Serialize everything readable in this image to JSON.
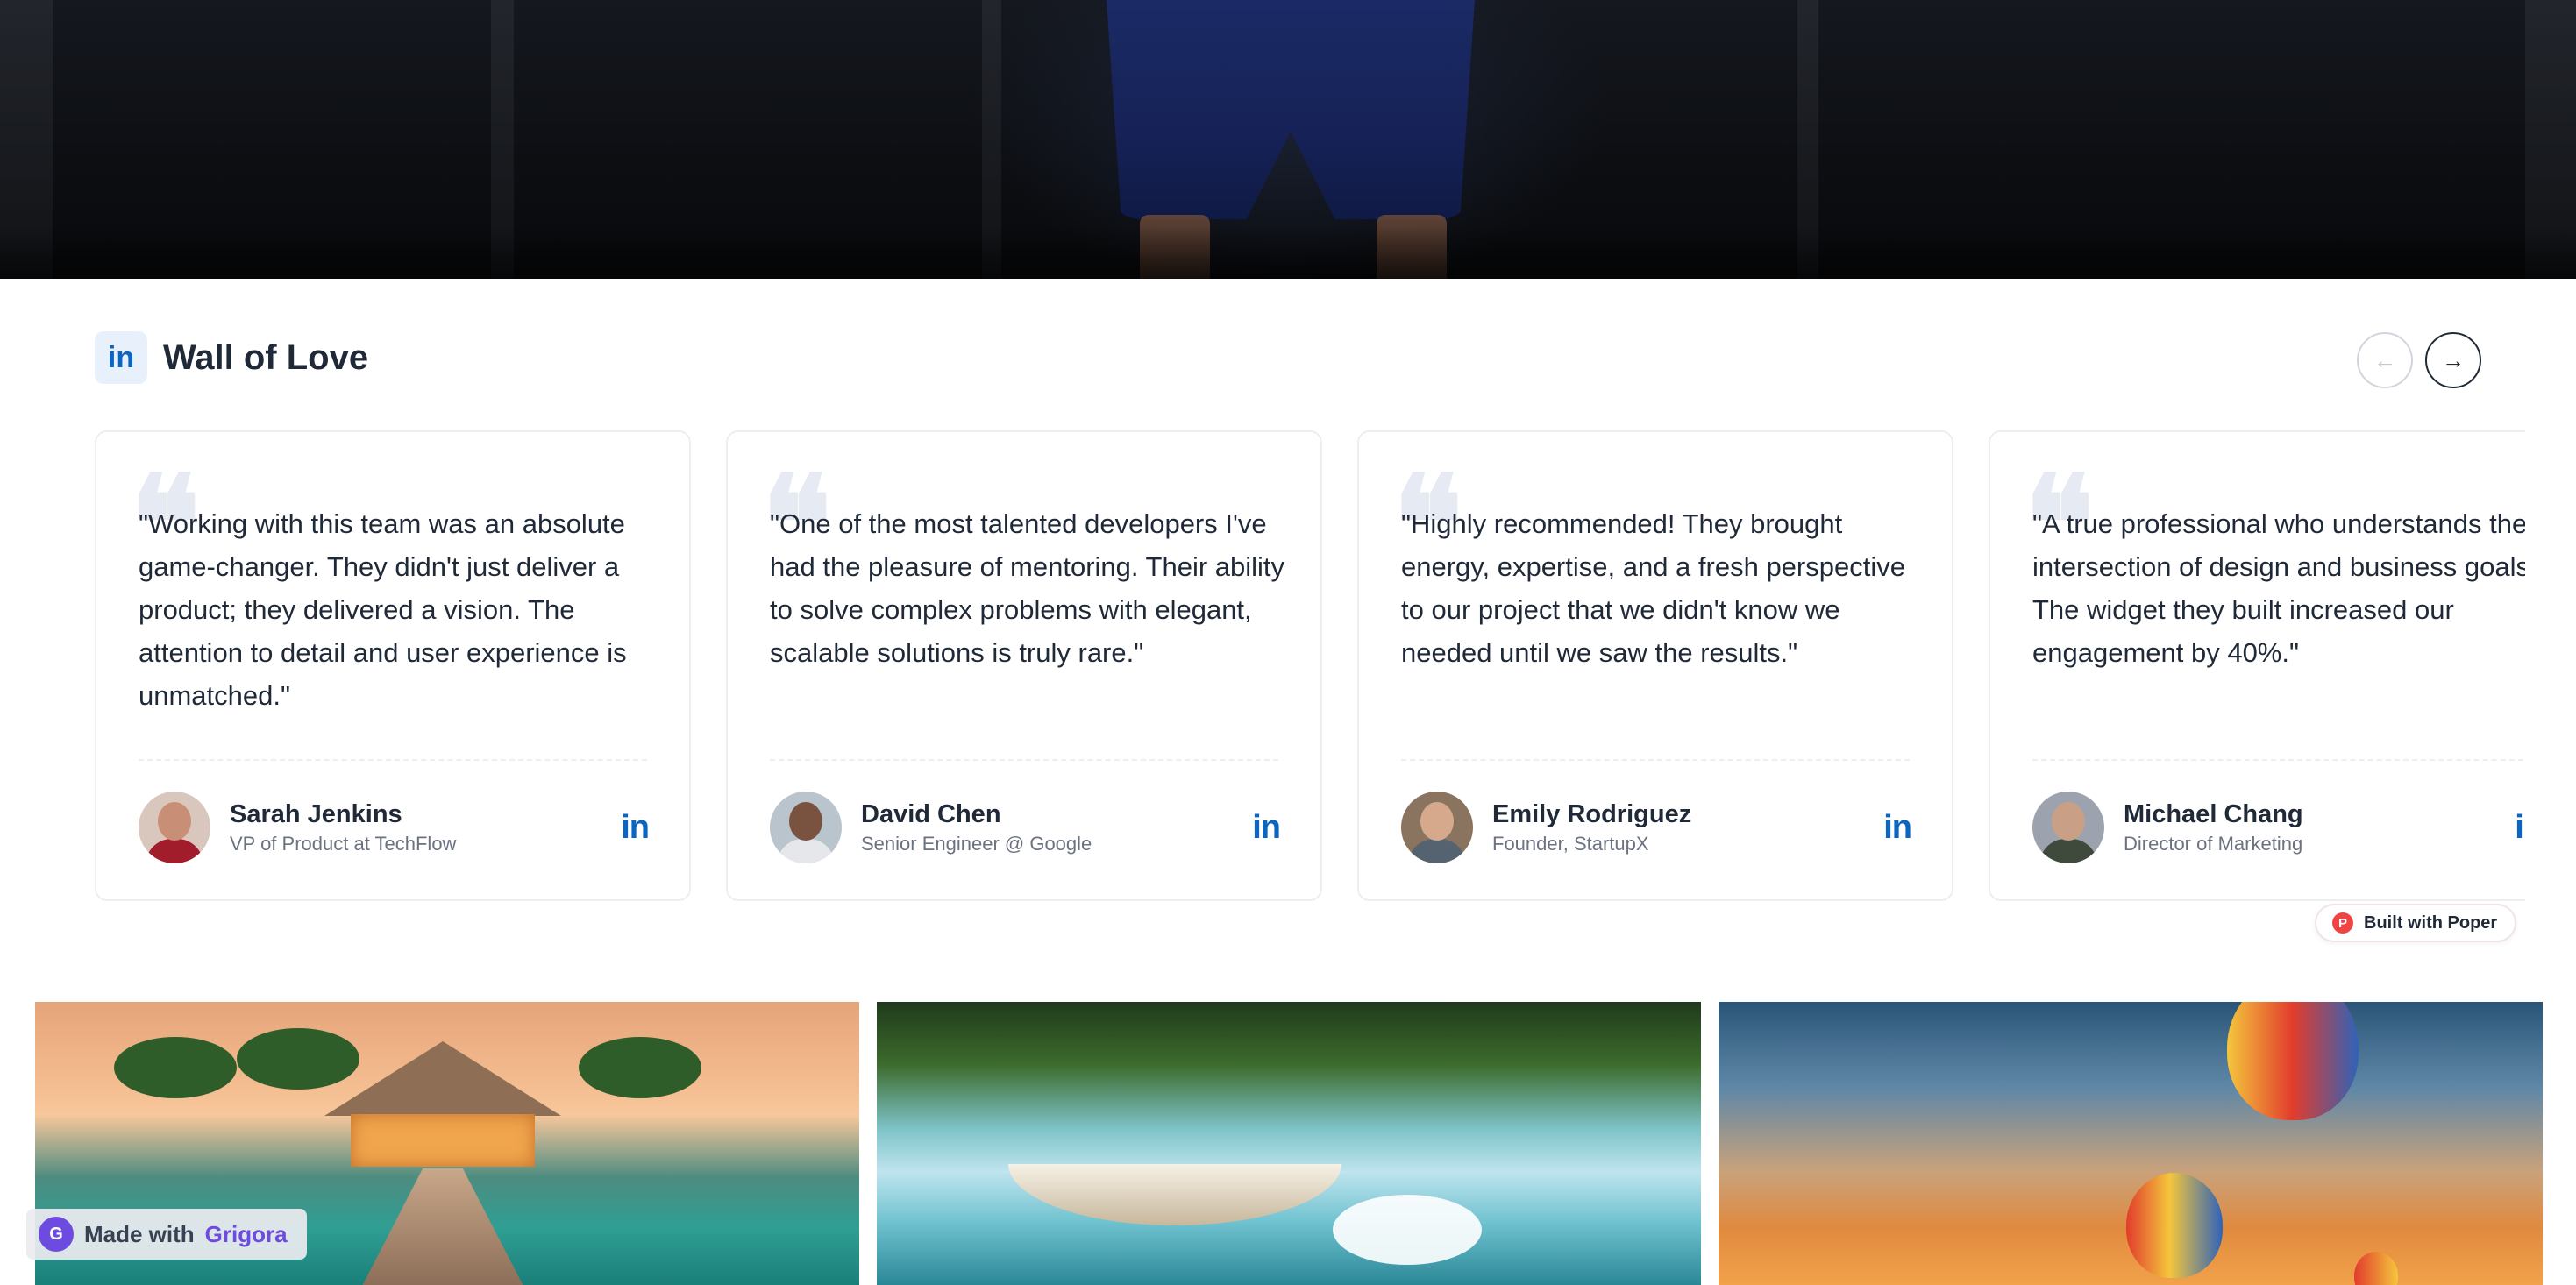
{
  "section": {
    "title": "Wall of Love",
    "linkedin_icon": "linkedin-icon",
    "prev_icon": "←",
    "next_icon": "→"
  },
  "testimonials": [
    {
      "quote": "\"Working with this team was an absolute game-changer. They didn't just deliver a product; they delivered a vision. The attention to detail and user experience is unmatched.\"",
      "name": "Sarah Jenkins",
      "role": "VP of Product at TechFlow"
    },
    {
      "quote": "\"One of the most talented developers I've had the pleasure of mentoring. Their ability to solve complex problems with elegant, scalable solutions is truly rare.\"",
      "name": "David Chen",
      "role": "Senior Engineer @ Google"
    },
    {
      "quote": "\"Highly recommended! They brought energy, expertise, and a fresh perspective to our project that we didn't know we needed until we saw the results.\"",
      "name": "Emily Rodriguez",
      "role": "Founder, StartupX"
    },
    {
      "quote": "\"A true professional who understands the intersection of design and business goals. The widget they built increased our engagement by 40%.\"",
      "name": "Michael Chang",
      "role": "Director of Marketing"
    }
  ],
  "badges": {
    "poper_label": "Built with Poper",
    "grigora_prefix": "Made with",
    "grigora_brand": "Grigora"
  },
  "colors": {
    "linkedin": "#0a66c2",
    "text": "#1f2937",
    "muted": "#6b7280",
    "grigora": "#6d4ae0"
  }
}
